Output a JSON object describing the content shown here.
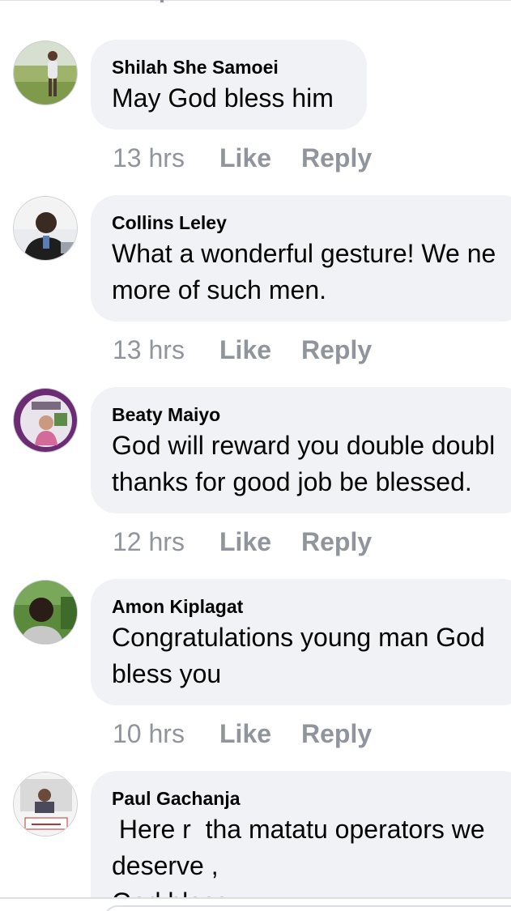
{
  "comments": [
    {
      "author": "Shilah She Samoei",
      "lines": [
        "May God bless him"
      ],
      "time": "13 hrs",
      "like_label": "Like",
      "reply_label": "Reply"
    },
    {
      "author": "Collins Leley",
      "lines": [
        "What a wonderful gesture! We ne",
        "more of such men."
      ],
      "time": "13 hrs",
      "like_label": "Like",
      "reply_label": "Reply"
    },
    {
      "author": "Beaty Maiyo",
      "lines": [
        "God will reward you double doubl",
        "thanks for good job be blessed."
      ],
      "time": "12 hrs",
      "like_label": "Like",
      "reply_label": "Reply"
    },
    {
      "author": "Amon Kiplagat",
      "lines": [
        "Congratulations young man God",
        "bless you"
      ],
      "time": "10 hrs",
      "like_label": "Like",
      "reply_label": "Reply"
    },
    {
      "author": "Paul Gachanja",
      "lines": [
        " Here r  tha matatu operators we",
        "deserve ,",
        "God bless"
      ],
      "time": "",
      "like_label": "",
      "reply_label": ""
    }
  ],
  "avatars": [
    "profile-photo",
    "profile-photo",
    "profile-photo",
    "profile-photo",
    "profile-photo"
  ],
  "colors": {
    "bubble": "#f0f2f5",
    "meta": "#90949c",
    "text": "#050505"
  }
}
